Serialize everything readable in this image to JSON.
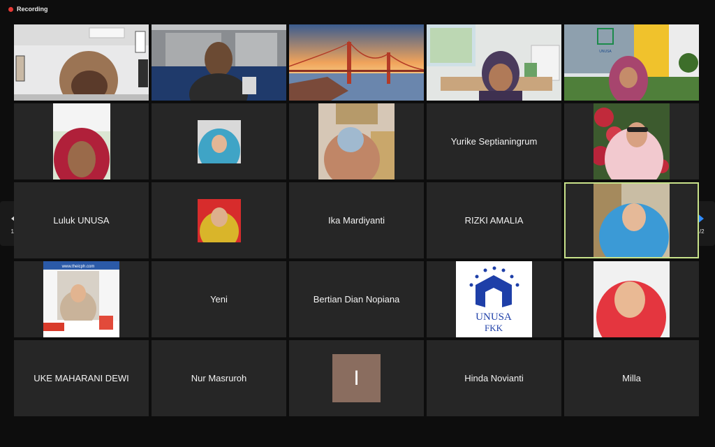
{
  "recording": {
    "label": "Recording"
  },
  "pagination": {
    "prev": "1/2",
    "next": "1/2"
  },
  "participants": {
    "yurike": "Yurike Septianingrum",
    "luluk": "Luluk UNUSA",
    "ika": "Ika Mardiyanti",
    "rizki": "RIZKI AMALIA",
    "yeni": "Yeni",
    "bertian": "Bertian Dian Nopiana",
    "uke": "UKE MAHARANI DEWI",
    "nur": "Nur Masruroh",
    "i_initial": "I",
    "hinda": "Hinda Novianti",
    "milla": "Milla"
  },
  "logo": {
    "unusa_fkk_line1": "UNUSA",
    "unusa_fkk_line2": "FKK",
    "campus_banner": "UNUSA",
    "conference_url": "www.theicph.com"
  }
}
